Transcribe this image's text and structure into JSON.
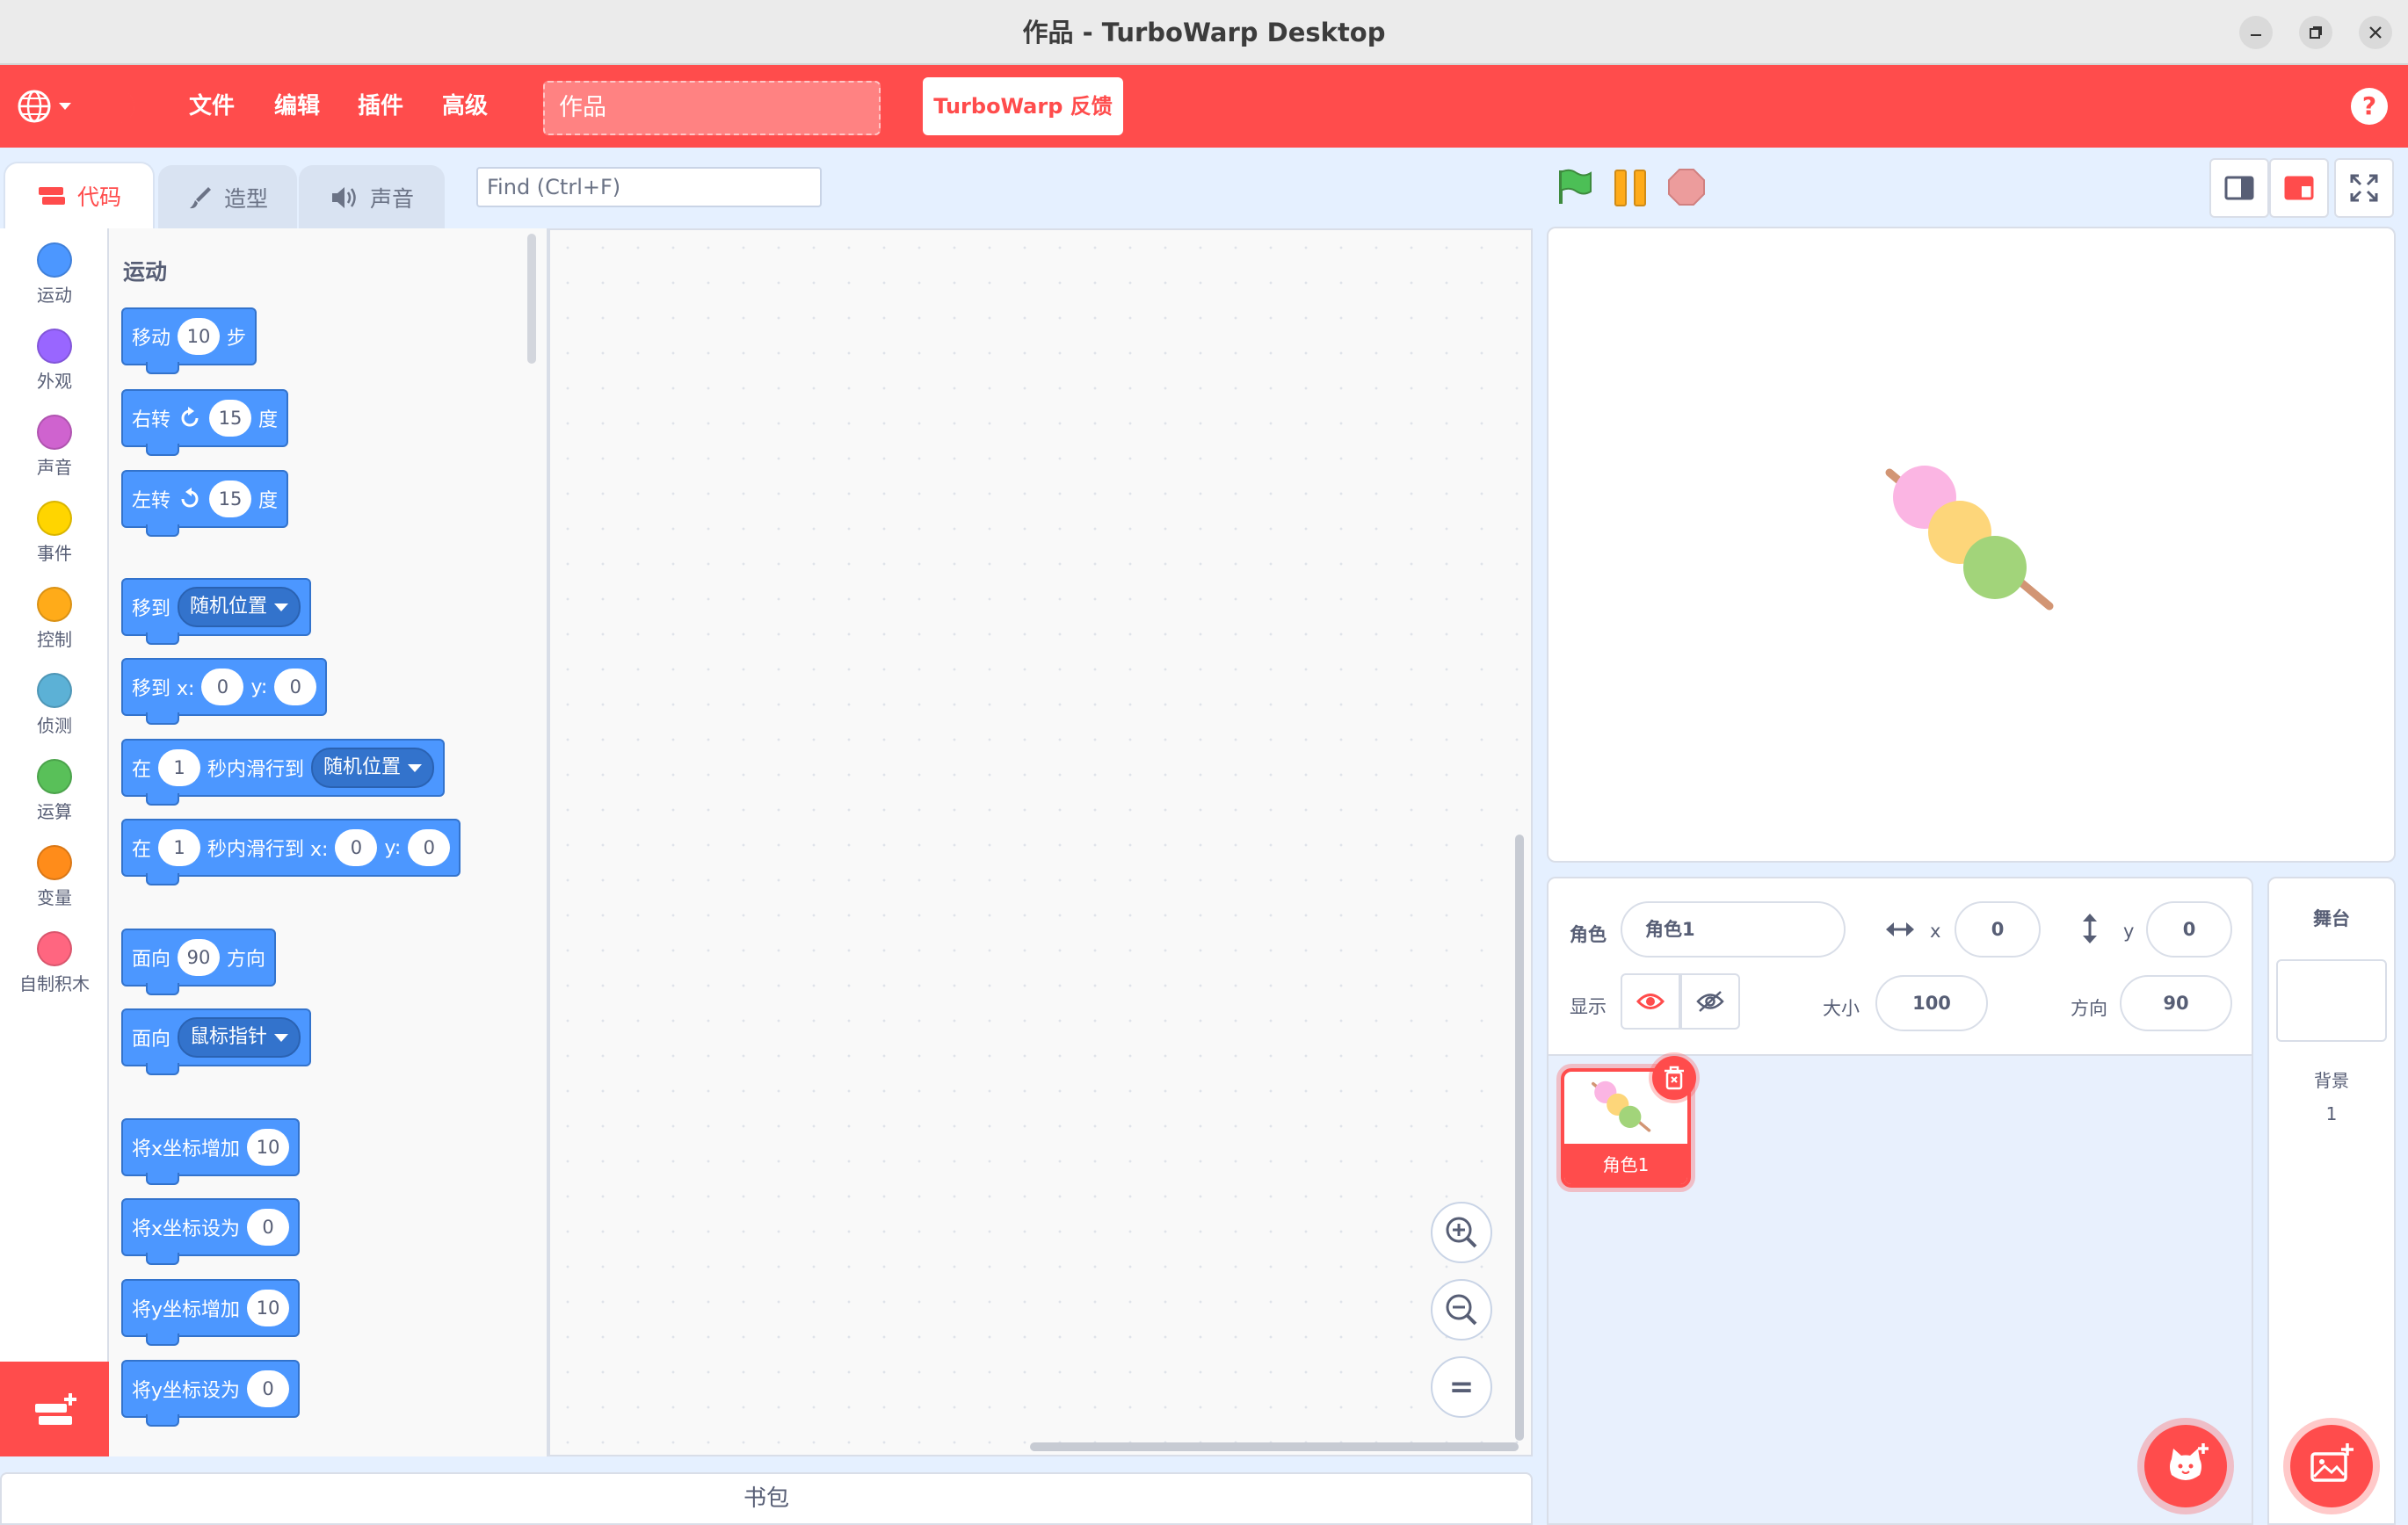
{
  "window": {
    "title": "作品 - TurboWarp Desktop"
  },
  "menu": {
    "items": [
      "文件",
      "编辑",
      "插件",
      "高级"
    ],
    "project_title": "作品",
    "feedback": "TurboWarp 反馈",
    "help": "?"
  },
  "tabs": {
    "code": "代码",
    "costumes": "造型",
    "sounds": "声音"
  },
  "find": {
    "placeholder": "Find (Ctrl+F)"
  },
  "categories": [
    {
      "label": "运动",
      "color": "#4c97ff"
    },
    {
      "label": "外观",
      "color": "#9966ff"
    },
    {
      "label": "声音",
      "color": "#cf63cf"
    },
    {
      "label": "事件",
      "color": "#ffd500"
    },
    {
      "label": "控制",
      "color": "#ffab19"
    },
    {
      "label": "侦测",
      "color": "#5cb1d6"
    },
    {
      "label": "运算",
      "color": "#59c059"
    },
    {
      "label": "变量",
      "color": "#ff8c1a"
    },
    {
      "label": "自制积木",
      "color": "#ff6680"
    }
  ],
  "palette": {
    "heading": "运动",
    "blocks": {
      "move": {
        "a": "移动",
        "n": "10",
        "b": "步"
      },
      "turn_right": {
        "a": "右转",
        "n": "15",
        "b": "度"
      },
      "turn_left": {
        "a": "左转",
        "n": "15",
        "b": "度"
      },
      "goto": {
        "a": "移到",
        "dd": "随机位置"
      },
      "goto_xy": {
        "a": "移到 x:",
        "x": "0",
        "b": "y:",
        "y": "0"
      },
      "glide": {
        "a": "在",
        "n": "1",
        "b": "秒内滑行到",
        "dd": "随机位置"
      },
      "glide_xy": {
        "a": "在",
        "n": "1",
        "b": "秒内滑行到 x:",
        "x": "0",
        "c": "y:",
        "y": "0"
      },
      "point_dir": {
        "a": "面向",
        "n": "90",
        "b": "方向"
      },
      "point_towards": {
        "a": "面向",
        "dd": "鼠标指针"
      },
      "change_x": {
        "a": "将x坐标增加",
        "n": "10"
      },
      "set_x": {
        "a": "将x坐标设为",
        "n": "0"
      },
      "change_y": {
        "a": "将y坐标增加",
        "n": "10"
      },
      "set_y": {
        "a": "将y坐标设为",
        "n": "0"
      }
    }
  },
  "zoom": {
    "reset": "="
  },
  "backpack": "书包",
  "sprite_info": {
    "sprite_label": "角色",
    "sprite_name": "角色1",
    "x_label": "x",
    "x": "0",
    "y_label": "y",
    "y": "0",
    "show_label": "显示",
    "size_label": "大小",
    "size": "100",
    "direction_label": "方向",
    "direction": "90"
  },
  "sprites": [
    {
      "name": "角色1"
    }
  ],
  "stage_panel": {
    "title": "舞台",
    "backdrops_label": "背景",
    "backdrops_count": "1"
  },
  "colors": {
    "accent": "#ff4c4c",
    "motion": "#4c97ff",
    "motion_dark": "#3373cc"
  }
}
